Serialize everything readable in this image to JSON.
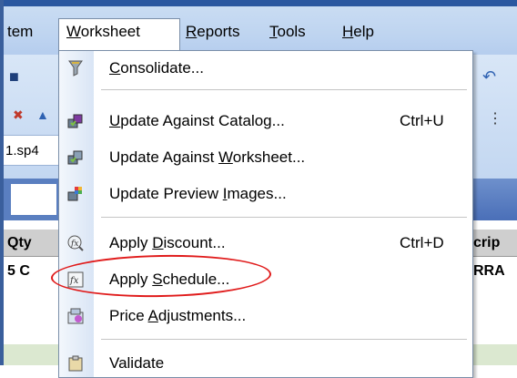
{
  "menubar": {
    "items": [
      {
        "label": "tem"
      },
      {
        "label_parts": [
          "W",
          "orksheet"
        ]
      },
      {
        "label_parts": [
          "R",
          "eports"
        ]
      },
      {
        "label_parts": [
          "T",
          "ools"
        ]
      },
      {
        "label_parts": [
          "H",
          "elp"
        ]
      }
    ]
  },
  "left_panel": {
    "file_tab": "1.sp4",
    "grid_header": "Qty",
    "grid_row": "5 C"
  },
  "right_panel": {
    "grid_header": "crip",
    "grid_row": "RRA"
  },
  "worksheet_menu": {
    "items": [
      {
        "pre": "",
        "key": "C",
        "post": "onsolidate...",
        "shortcut": "",
        "icon": "consolidate-icon"
      },
      {
        "pre": "",
        "key": "U",
        "post": "pdate Against Catalog...",
        "shortcut": "Ctrl+U",
        "icon": "update-catalog-icon"
      },
      {
        "pre": "Update Against ",
        "key": "W",
        "post": "orksheet...",
        "shortcut": "",
        "icon": "update-worksheet-icon"
      },
      {
        "pre": "Update Preview ",
        "key": "I",
        "post": "mages...",
        "shortcut": "",
        "icon": "update-preview-icon"
      },
      {
        "pre": "Apply ",
        "key": "D",
        "post": "iscount...",
        "shortcut": "Ctrl+D",
        "icon": "apply-discount-icon"
      },
      {
        "pre": "Apply ",
        "key": "S",
        "post": "chedule...",
        "shortcut": "",
        "icon": "apply-schedule-icon"
      },
      {
        "pre": "Price ",
        "key": "A",
        "post": "djustments...",
        "shortcut": "",
        "icon": "price-adjustments-icon"
      },
      {
        "pre": "Validate",
        "key": "",
        "post": "",
        "shortcut": "",
        "icon": "validate-icon"
      }
    ]
  },
  "colors": {
    "menubar_top": "#2a57a0",
    "highlight": "#e01b1b",
    "menu_border": "#7a8ea8"
  }
}
